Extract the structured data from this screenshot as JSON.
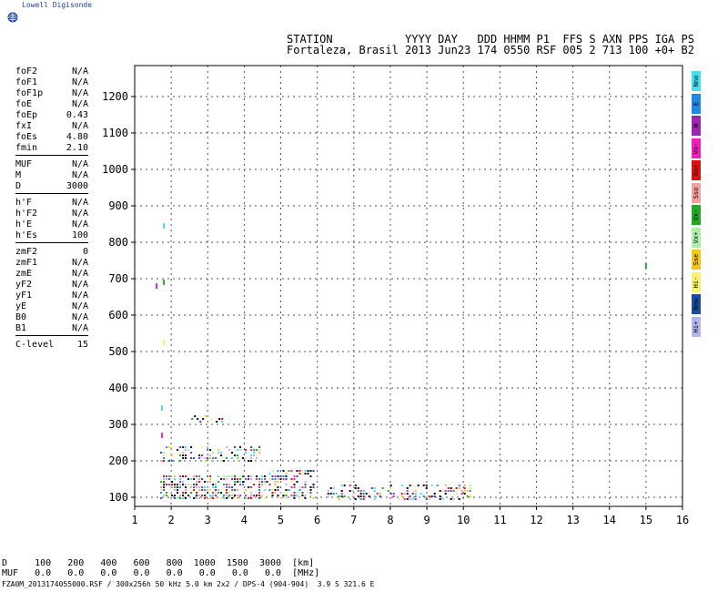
{
  "header": {
    "brand": "Lowell Digisonde",
    "line1": "STATION           YYYY DAY   DDD HHMM P1  FFS S AXN PPS IGA PS",
    "line2": "Fortaleza, Brasil 2013 Jun23 174 0550 RSF 005 2 713 100 +0+ B2"
  },
  "params_group1": [
    {
      "name": "foF2",
      "value": "N/A"
    },
    {
      "name": "foF1",
      "value": "N/A"
    },
    {
      "name": "foF1p",
      "value": "N/A"
    },
    {
      "name": "foE",
      "value": "N/A"
    },
    {
      "name": "foEp",
      "value": "0.43"
    },
    {
      "name": "fxI",
      "value": "N/A"
    },
    {
      "name": "foEs",
      "value": "4.80"
    },
    {
      "name": "fmin",
      "value": "2.10"
    }
  ],
  "params_group2": [
    {
      "name": "MUF",
      "value": "N/A"
    },
    {
      "name": "M",
      "value": "N/A"
    },
    {
      "name": "D",
      "value": "3000"
    }
  ],
  "params_group3": [
    {
      "name": "h'F",
      "value": "N/A"
    },
    {
      "name": "h'F2",
      "value": "N/A"
    },
    {
      "name": "h'E",
      "value": "N/A"
    },
    {
      "name": "h'Es",
      "value": "100"
    }
  ],
  "params_group4": [
    {
      "name": "zmF2",
      "value": "0"
    },
    {
      "name": "zmF1",
      "value": "N/A"
    },
    {
      "name": "zmE",
      "value": "N/A"
    },
    {
      "name": "yF2",
      "value": "N/A"
    },
    {
      "name": "yF1",
      "value": "N/A"
    },
    {
      "name": "yE",
      "value": "N/A"
    },
    {
      "name": "B0",
      "value": "N/A"
    },
    {
      "name": "B1",
      "value": "N/A"
    }
  ],
  "clevel": {
    "name": "C-level",
    "value": "15"
  },
  "legend": [
    {
      "label": "Nno",
      "color": "#44ddee"
    },
    {
      "label": "E",
      "color": "#1e88e5"
    },
    {
      "label": "W",
      "color": "#9c27b0"
    },
    {
      "label": "Vo-",
      "color": "#ee22bb"
    },
    {
      "label": "Xo+",
      "color": "#dd1111"
    },
    {
      "label": "Sso",
      "color": "#f4a0a0"
    },
    {
      "label": "Vx-",
      "color": "#22aa22"
    },
    {
      "label": "Vx+",
      "color": "#aaf0aa"
    },
    {
      "label": "Sse",
      "color": "#f5c518"
    },
    {
      "label": "Hi-",
      "color": "#f8f070"
    },
    {
      "label": "Nnw",
      "color": "#1a4e9a"
    },
    {
      "label": "Hi+",
      "color": "#b4b4ee"
    }
  ],
  "footer": {
    "d_row": "D     100   200   400   600   800  1000  1500  3000  [km]",
    "muf_row": "MUF   0.0   0.0   0.0   0.0   0.0   0.0   0.0   0.0  [MHz]",
    "file_row": "FZA0M_2013174055000.RSF / 300x256h 50 kHz 5.0 km 2x2 / DPS-4 (904-904)  3.9 S 321.6 E"
  },
  "chart_data": {
    "type": "scatter",
    "xlim": [
      1,
      16
    ],
    "ylim": [
      75,
      1285
    ],
    "x_ticks": [
      "1",
      "2",
      "3",
      "4",
      "5",
      "6",
      "7",
      "8",
      "9",
      "10",
      "11",
      "12",
      "13",
      "14",
      "15",
      "16"
    ],
    "y_ticks": [
      "100",
      "200",
      "300",
      "400",
      "500",
      "600",
      "700",
      "800",
      "900",
      "1000",
      "1100",
      "1200"
    ],
    "grid": true,
    "echo_regions": [
      {
        "x0": 1.7,
        "x1": 4.6,
        "y0": 95,
        "y1": 160,
        "density": 0.55
      },
      {
        "x0": 4.6,
        "x1": 5.9,
        "y0": 95,
        "y1": 175,
        "density": 0.45
      },
      {
        "x0": 6.2,
        "x1": 10.2,
        "y0": 95,
        "y1": 135,
        "density": 0.35
      },
      {
        "x0": 1.7,
        "x1": 4.4,
        "y0": 200,
        "y1": 240,
        "density": 0.35
      },
      {
        "x0": 2.4,
        "x1": 3.4,
        "y0": 305,
        "y1": 325,
        "density": 0.25
      }
    ],
    "isolated_points": [
      {
        "x": 1.8,
        "y": 845
      },
      {
        "x": 1.6,
        "y": 680
      },
      {
        "x": 1.8,
        "y": 690
      },
      {
        "x": 1.8,
        "y": 525
      },
      {
        "x": 1.75,
        "y": 345
      },
      {
        "x": 1.75,
        "y": 270
      },
      {
        "x": 15.0,
        "y": 735
      }
    ]
  }
}
